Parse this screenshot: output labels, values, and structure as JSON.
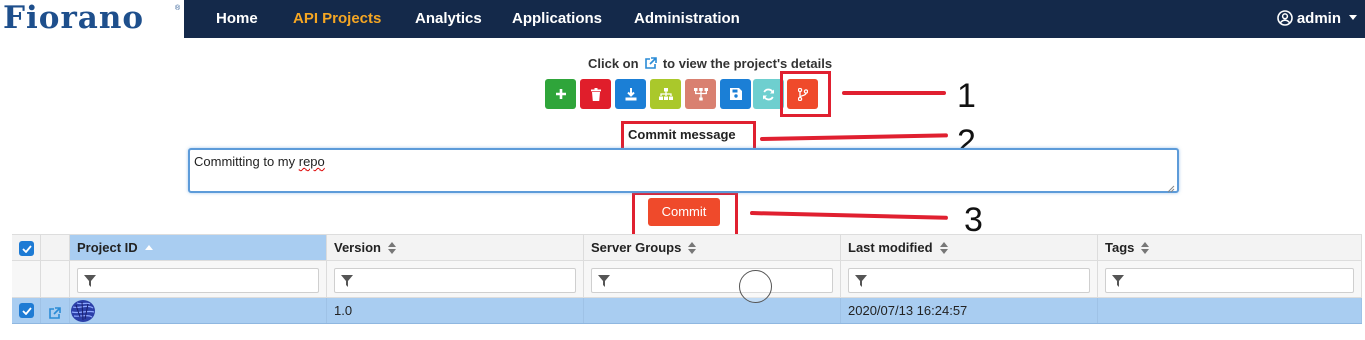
{
  "brand": {
    "logo_text": "Fiorano",
    "tm": "®"
  },
  "nav": {
    "items": [
      {
        "label": "Home",
        "active": false
      },
      {
        "label": "API Projects",
        "active": true
      },
      {
        "label": "Analytics",
        "active": false
      },
      {
        "label": "Applications",
        "active": false
      },
      {
        "label": "Administration",
        "active": false
      }
    ],
    "user_label": "admin"
  },
  "hint": {
    "prefix": "Click on",
    "suffix": "to view the project's details"
  },
  "toolbar": {
    "buttons": [
      {
        "name": "add",
        "icon": "plus-icon",
        "color": "#2fa53a"
      },
      {
        "name": "delete",
        "icon": "trash-icon",
        "color": "#e01e2b"
      },
      {
        "name": "download",
        "icon": "download-icon",
        "color": "#1b7fd6"
      },
      {
        "name": "hierarchy",
        "icon": "sitemap-icon",
        "color": "#aac82b"
      },
      {
        "name": "deploy",
        "icon": "deploy-tree-icon",
        "color": "#d98070"
      },
      {
        "name": "save",
        "icon": "save-icon",
        "color": "#1b7fd6"
      },
      {
        "name": "refresh",
        "icon": "refresh-icon",
        "color": "#6ecfcf"
      },
      {
        "name": "git-commit",
        "icon": "code-branch-icon",
        "color": "#ef4a2b"
      }
    ]
  },
  "commit": {
    "label": "Commit message",
    "message_before": "Committing to my ",
    "message_squiggle": "repo",
    "button_label": "Commit"
  },
  "annotations": {
    "n1": "1",
    "n2": "2",
    "n3": "3",
    "color": "#e02030"
  },
  "grid": {
    "columns": [
      {
        "label": "Project ID",
        "sort": "asc"
      },
      {
        "label": "Version",
        "sort": "both"
      },
      {
        "label": "Server Groups",
        "sort": "both"
      },
      {
        "label": "Last modified",
        "sort": "both"
      },
      {
        "label": "Tags",
        "sort": "both"
      }
    ],
    "rows": [
      {
        "selected": true,
        "project_id": "",
        "version": "1.0",
        "server_groups": "",
        "last_modified": "2020/07/13 16:24:57",
        "tags": ""
      }
    ]
  },
  "colors": {
    "nav_bg": "#14294a",
    "nav_active": "#f5a623",
    "selected_row": "#a9cdf1",
    "accent_blue": "#1e7bd4"
  }
}
